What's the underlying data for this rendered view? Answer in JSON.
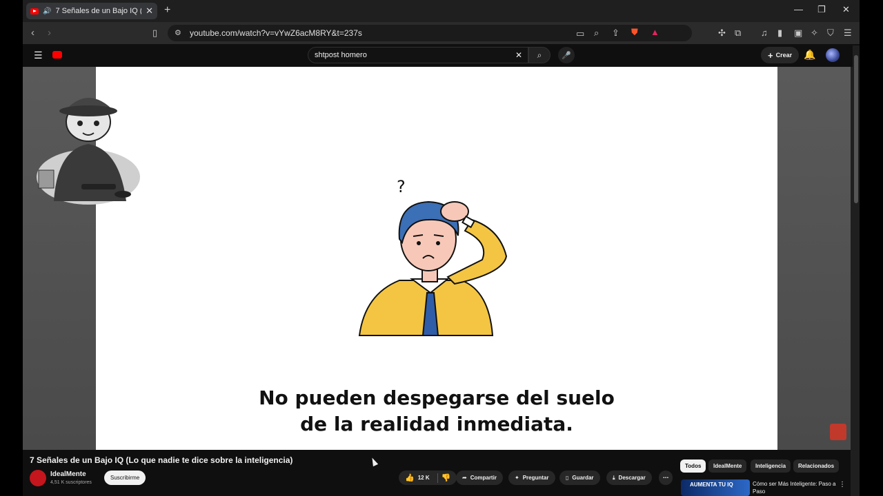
{
  "browser": {
    "tab_title": "7 Señales de un Bajo IQ (Lo q",
    "url": "youtube.com/watch?v=vYwZ6acM8RY&t=237s"
  },
  "youtube": {
    "search_value": "shtpost homero",
    "create_label": "Crear"
  },
  "video": {
    "caption_line1": "No pueden despegarse del suelo",
    "caption_line2": "de la realidad inmediata.",
    "question_mark": "?"
  },
  "meta": {
    "title": "7 Señales de un Bajo IQ (Lo que nadie te dice sobre la inteligencia)",
    "channel": "IdealMente",
    "subscribers": "4,51 K suscriptores",
    "subscribe_label": "Suscribirme",
    "likes": "12 K",
    "share_label": "Compartir",
    "ask_label": "Preguntar",
    "save_label": "Guardar",
    "download_label": "Descargar"
  },
  "chips": [
    "Todos",
    "IdealMente",
    "Inteligencia",
    "Relacionados"
  ],
  "recommendation": {
    "thumb_text": "AUMENTA TU IQ",
    "title": "Cómo ser Más Inteligente: Paso a Paso"
  },
  "colors": {
    "accent_red": "#ff0000",
    "shirt_yellow": "#f4c542",
    "hair_blue": "#3b6fb6"
  }
}
